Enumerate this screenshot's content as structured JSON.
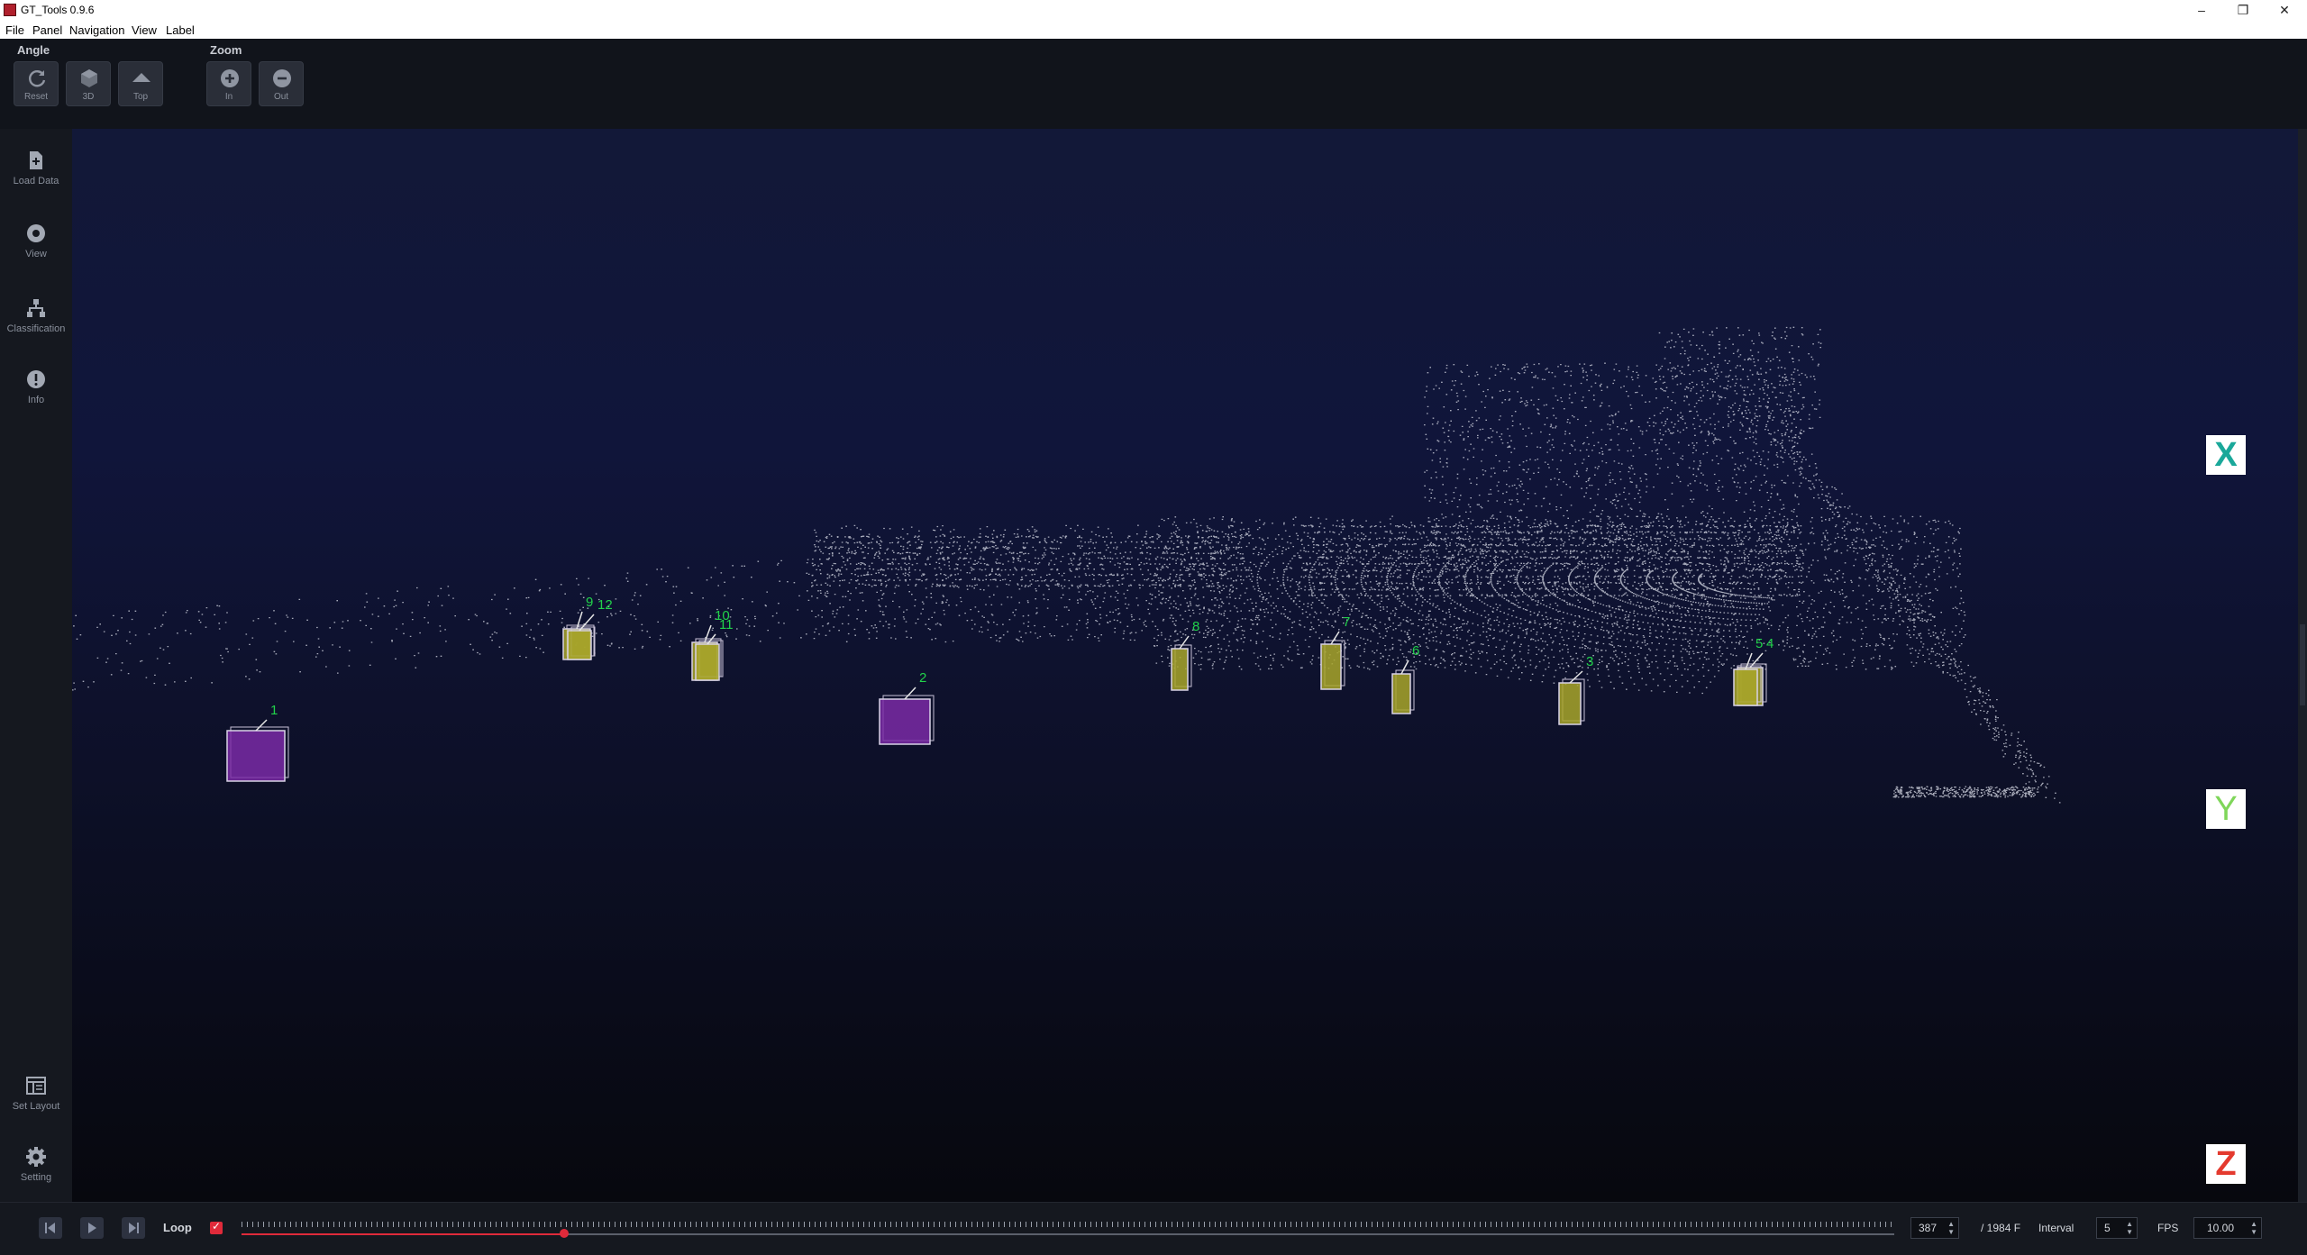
{
  "window": {
    "title": "GT_Tools 0.9.6",
    "minimize": "–",
    "maximize": "❐",
    "close": "✕"
  },
  "menu": [
    "File",
    "Panel",
    "Navigation",
    "View",
    "Label"
  ],
  "toolbar": {
    "angle_label": "Angle",
    "zoom_label": "Zoom",
    "buttons": [
      {
        "label": "Reset",
        "icon": "refresh-icon"
      },
      {
        "label": "3D",
        "icon": "cube-icon"
      },
      {
        "label": "Top",
        "icon": "top-view-icon"
      },
      {
        "label": "In",
        "icon": "zoom-in-icon"
      },
      {
        "label": "Out",
        "icon": "zoom-out-icon"
      }
    ]
  },
  "sidebar": {
    "items": [
      {
        "label": "Load Data",
        "icon": "file-icon"
      },
      {
        "label": "View",
        "icon": "eye-icon"
      },
      {
        "label": "Classification",
        "icon": "hierarchy-icon"
      },
      {
        "label": "Info",
        "icon": "info-icon"
      },
      {
        "label": "Set Layout",
        "icon": "layout-icon"
      },
      {
        "label": "Setting",
        "icon": "gear-icon"
      }
    ]
  },
  "viewport": {
    "axes": [
      {
        "label": "X",
        "color": "#1aa89a"
      },
      {
        "label": "Y",
        "color": "#7fd65a"
      },
      {
        "label": "Z",
        "color": "#e43a2e"
      }
    ],
    "objects": [
      {
        "id": "1",
        "class": "large",
        "color": "#7a2aa6"
      },
      {
        "id": "2",
        "class": "large",
        "color": "#7a2aa6"
      },
      {
        "id": "3",
        "class": "small",
        "color": "#a8a62a"
      },
      {
        "id": "4",
        "class": "small",
        "color": "#a8a62a"
      },
      {
        "id": "5",
        "class": "small",
        "color": "#a8a62a"
      },
      {
        "id": "6",
        "class": "small",
        "color": "#a8a62a"
      },
      {
        "id": "7",
        "class": "small",
        "color": "#a8a62a"
      },
      {
        "id": "8",
        "class": "small",
        "color": "#a8a62a"
      },
      {
        "id": "9",
        "class": "small",
        "color": "#a8a62a"
      },
      {
        "id": "10",
        "class": "small",
        "color": "#a8a62a"
      },
      {
        "id": "11",
        "class": "small",
        "color": "#a8a62a"
      },
      {
        "id": "12",
        "class": "small",
        "color": "#a8a62a"
      }
    ]
  },
  "playback": {
    "loop_label": "Loop",
    "loop_checked": true,
    "current_frame": "387",
    "total_frames": "/ 1984 F",
    "interval_label": "Interval",
    "interval_value": "5",
    "fps_label": "FPS",
    "fps_value": "10.00",
    "progress": 0.195
  }
}
